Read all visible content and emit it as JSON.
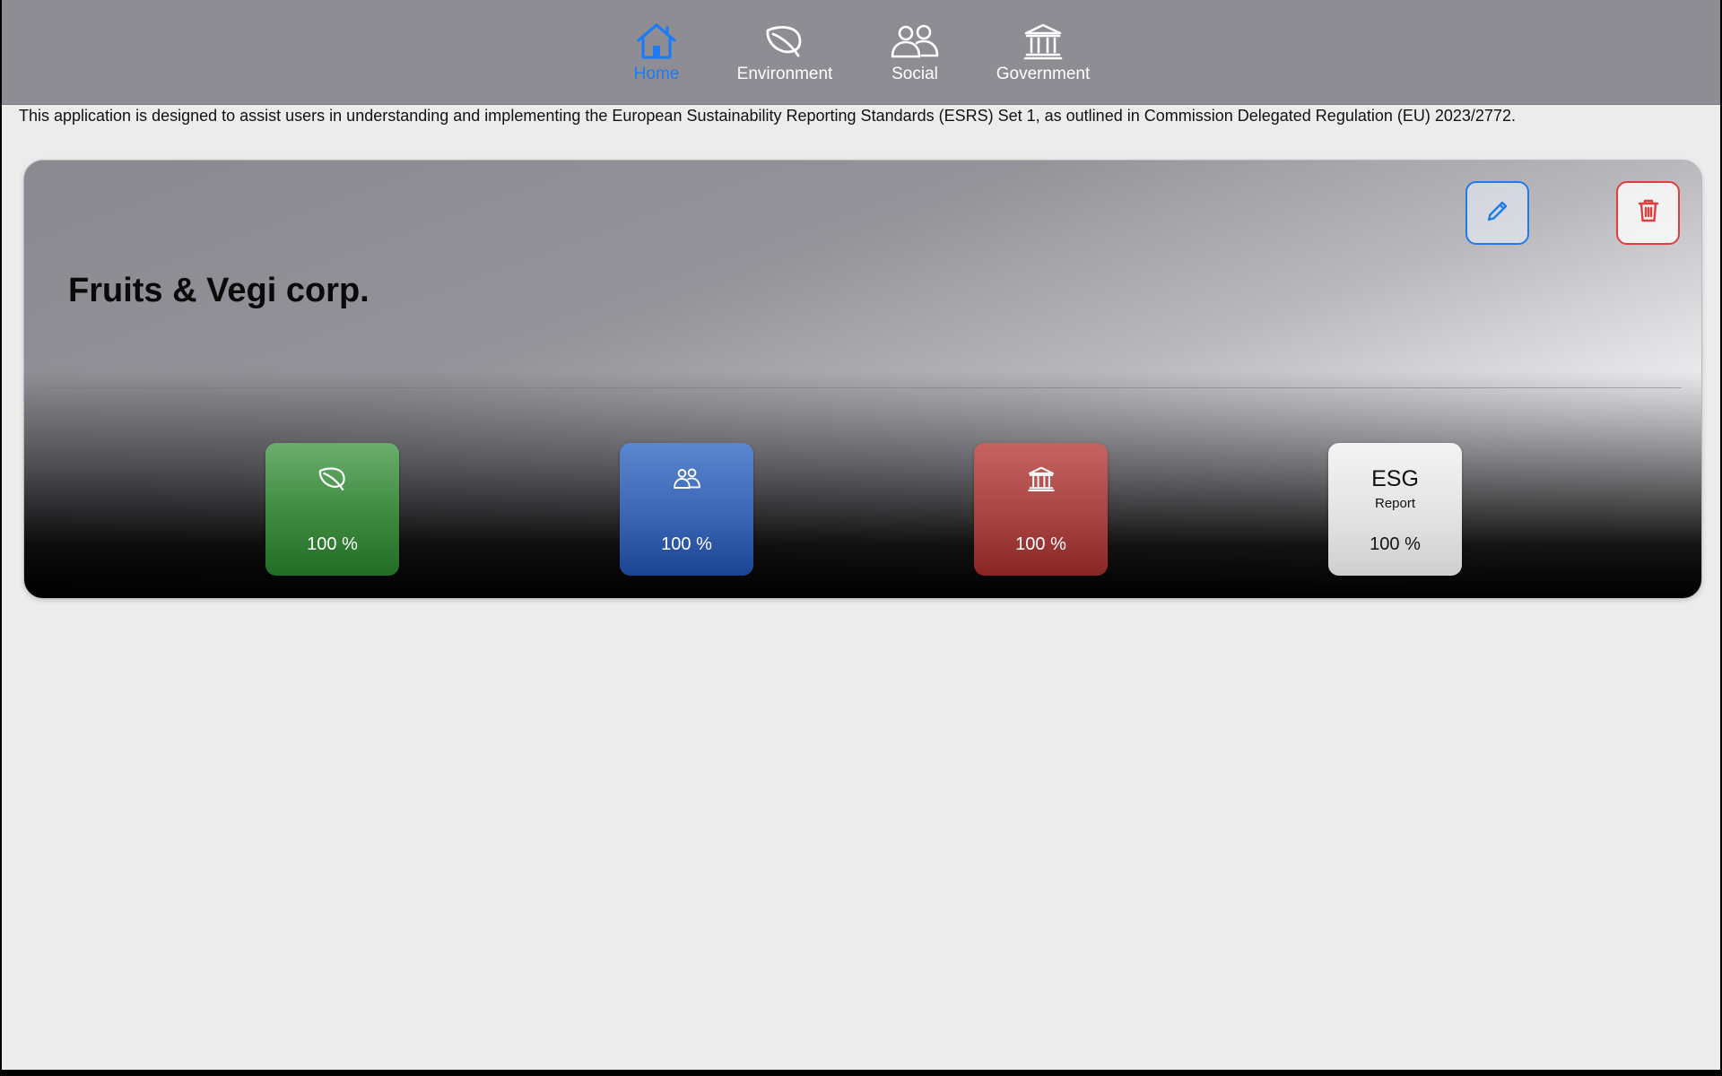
{
  "tabs": [
    {
      "id": "home",
      "label": "Home",
      "icon": "house-icon",
      "active": true
    },
    {
      "id": "environment",
      "label": "Environment",
      "icon": "leaf-icon",
      "active": false
    },
    {
      "id": "social",
      "label": "Social",
      "icon": "people-icon",
      "active": false
    },
    {
      "id": "government",
      "label": "Government",
      "icon": "building-columns-icon",
      "active": false
    }
  ],
  "intro_text": "This application is designed to assist users in understanding and implementing the European Sustainability Reporting Standards (ESRS) Set 1, as outlined in Commission Delegated Regulation (EU) 2023/2772.",
  "company": {
    "name": "Fruits & Vegi corp.",
    "edit_icon": "pencil-icon",
    "delete_icon": "trash-icon",
    "tiles": {
      "environment": {
        "icon": "leaf-icon",
        "percent_label": "100 %",
        "color": "#3d8a3f"
      },
      "social": {
        "icon": "people-icon",
        "percent_label": "100 %",
        "color": "#3b66b4"
      },
      "government": {
        "icon": "building-columns-icon",
        "percent_label": "100 %",
        "color": "#a84441"
      },
      "esg": {
        "title": "ESG",
        "subtitle": "Report",
        "percent_label": "100 %",
        "color": "#e3e3e3"
      }
    }
  },
  "colors": {
    "accent": "#1a7cf7",
    "tabbar_bg": "#8e8d93",
    "page_bg": "#ececec",
    "edit_border": "#1e7bea",
    "delete_border": "#e23c3c"
  }
}
